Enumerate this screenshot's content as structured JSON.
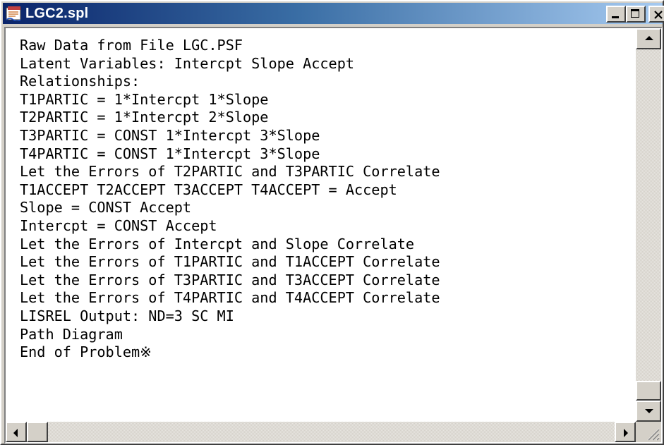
{
  "window": {
    "title": "LGC2.spl",
    "app_icon": "spl-document-icon",
    "buttons": {
      "minimize": "minimize-icon",
      "maximize": "maximize-icon",
      "close": "close-icon"
    }
  },
  "editor": {
    "lines": [
      "Raw Data from File LGC.PSF",
      "Latent Variables: Intercpt Slope Accept",
      "Relationships:",
      "T1PARTIC = 1*Intercpt 1*Slope",
      "T2PARTIC = 1*Intercpt 2*Slope",
      "T3PARTIC = CONST 1*Intercpt 3*Slope",
      "T4PARTIC = CONST 1*Intercpt 3*Slope",
      "Let the Errors of T2PARTIC and T3PARTIC Correlate",
      "T1ACCEPT T2ACCEPT T3ACCEPT T4ACCEPT = Accept",
      "Slope = CONST Accept",
      "Intercpt = CONST Accept",
      "Let the Errors of Intercpt and Slope Correlate",
      "Let the Errors of T1PARTIC and T1ACCEPT Correlate",
      "Let the Errors of T3PARTIC and T3ACCEPT Correlate",
      "Let the Errors of T4PARTIC and T4ACCEPT Correlate",
      "LISREL Output: ND=3 SC MI",
      "Path Diagram",
      "End of Problem※"
    ]
  },
  "scrollbars": {
    "vertical": {
      "up": "arrow-up-icon",
      "down": "arrow-down-icon"
    },
    "horizontal": {
      "left": "arrow-left-icon",
      "right": "arrow-right-icon"
    }
  },
  "colors": {
    "titlebar_start": "#0a246a",
    "titlebar_end": "#a6caf0",
    "face": "#d4d0c8",
    "text": "#000000"
  }
}
